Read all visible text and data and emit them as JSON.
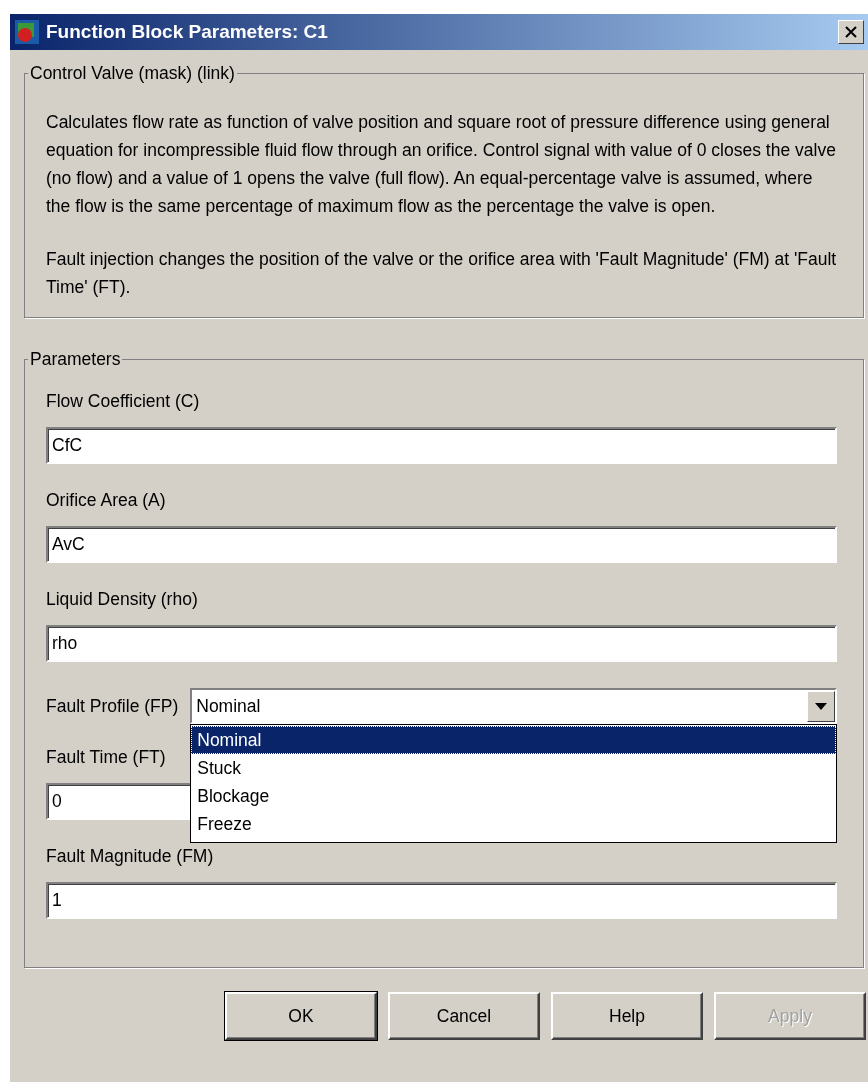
{
  "window": {
    "title": "Function Block Parameters: C1"
  },
  "description": {
    "title": "Control Valve (mask) (link)",
    "paragraphs": [
      "Calculates flow rate as function of valve position and square root of pressure difference using general equation for incompressible fluid flow through an orifice. Control signal with value of 0 closes the valve (no flow) and a value of 1 opens the valve (full flow). An equal-percentage valve is assumed, where the flow is the same percentage of maximum flow as the percentage the valve is open.",
      "Fault injection changes the position of the valve or the orifice area with 'Fault Magnitude' (FM) at 'Fault Time' (FT)."
    ]
  },
  "parameters": {
    "title": "Parameters",
    "items": [
      {
        "kind": "text",
        "label": "Flow Coefficient (C)",
        "value": "CfC"
      },
      {
        "kind": "text",
        "label": "Orifice Area (A)",
        "value": "AvC"
      },
      {
        "kind": "text",
        "label": "Liquid Density (rho)",
        "value": "rho"
      },
      {
        "kind": "dropdown",
        "label": "Fault Profile (FP)",
        "value": "Nominal",
        "expanded": true,
        "options": [
          {
            "label": "Nominal",
            "selected": true
          },
          {
            "label": "Stuck",
            "selected": false
          },
          {
            "label": "Blockage",
            "selected": false
          },
          {
            "label": "Freeze",
            "selected": false
          }
        ]
      },
      {
        "kind": "text",
        "label": "Fault Time (FT)",
        "value": "0"
      },
      {
        "kind": "text",
        "label": "Fault Magnitude (FM)",
        "value": "1"
      }
    ]
  },
  "buttons": [
    {
      "label": "OK",
      "disabled": false,
      "default": true
    },
    {
      "label": "Cancel",
      "disabled": false,
      "default": false
    },
    {
      "label": "Help",
      "disabled": false,
      "default": false
    },
    {
      "label": "Apply",
      "disabled": true,
      "default": false
    }
  ]
}
